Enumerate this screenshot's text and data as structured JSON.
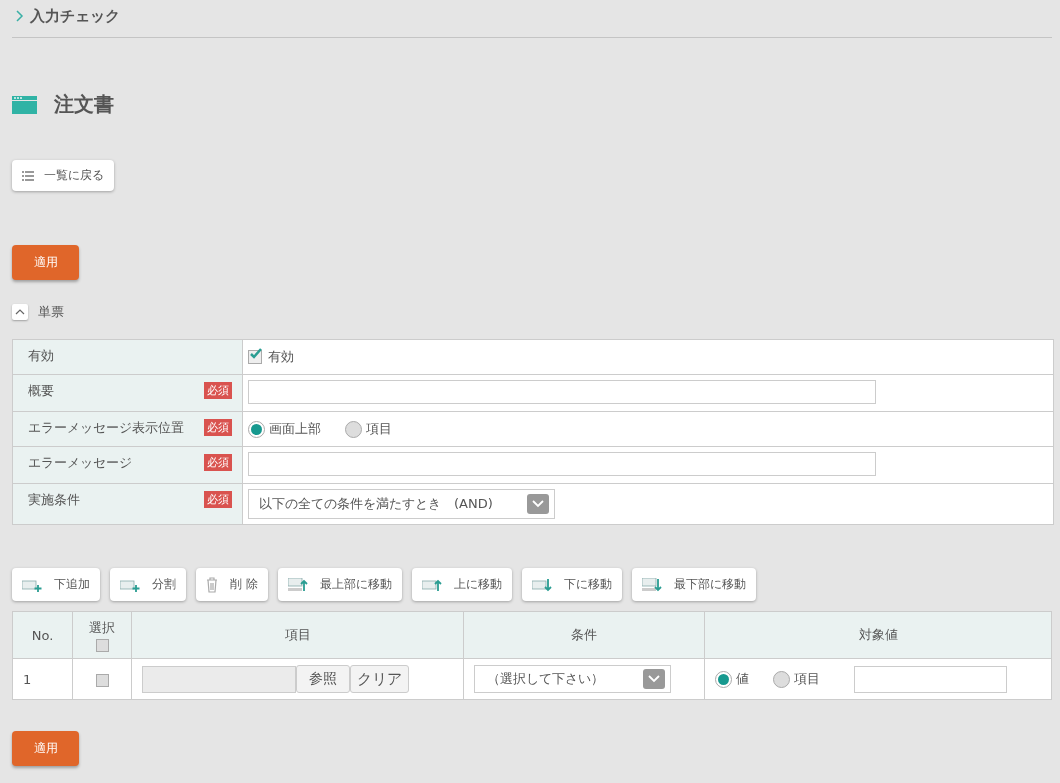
{
  "breadcrumb": "入力チェック",
  "page_title": "注文書",
  "back_button": "一覧に戻る",
  "top_apply_button": "適用",
  "section": {
    "title": "単票",
    "expanded": true
  },
  "form_rows": [
    {
      "label": "有効",
      "kind": "checkbox",
      "option": "有効",
      "checked": true
    },
    {
      "label": "概要",
      "badge": "必須",
      "kind": "text"
    },
    {
      "label": "エラーメッセージ表示位置",
      "badge": "必須",
      "kind": "radio",
      "options": [
        {
          "label": "画面上部",
          "selected": true
        },
        {
          "label": "項目",
          "selected": false
        }
      ]
    },
    {
      "label": "エラーメッセージ",
      "badge": "必須",
      "kind": "text"
    },
    {
      "label": "実施条件",
      "badge": "必須",
      "kind": "select",
      "value": "以下の全ての条件を満たすとき　(AND)"
    }
  ],
  "toolbar": [
    {
      "label": "下追加",
      "kind": "add"
    },
    {
      "label": "分割",
      "kind": "split"
    },
    {
      "label": "削 除",
      "kind": "delete"
    },
    {
      "label": "最上部に移動",
      "kind": "top"
    },
    {
      "label": "上に移動",
      "kind": "up"
    },
    {
      "label": "下に移動",
      "kind": "down"
    },
    {
      "label": "最下部に移動",
      "kind": "bottom"
    }
  ],
  "table": {
    "columns": [
      "No.",
      "選択",
      "項目",
      "条件",
      "対象値"
    ],
    "select_all_checked": false,
    "rows": [
      {
        "no": "1",
        "checked": false,
        "browse_button": "参照",
        "clear_button": "クリア",
        "condition": "（選択して下さい）",
        "target_options": [
          {
            "label": "値",
            "selected": true
          },
          {
            "label": "項目",
            "selected": false
          }
        ]
      }
    ]
  },
  "bottom_apply_button": "適用"
}
